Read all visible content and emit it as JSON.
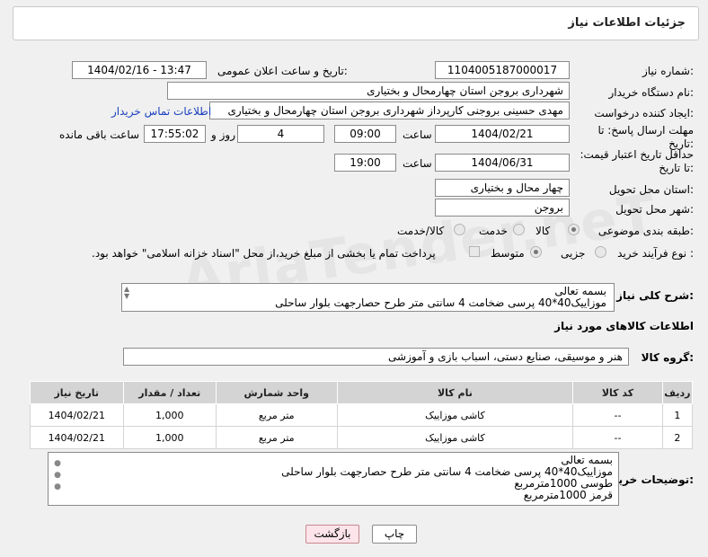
{
  "header": {
    "title": "جزئیات اطلاعات نیاز"
  },
  "watermark": "AriaTender.neT",
  "fields": {
    "need_number_label": "شماره نیاز:",
    "need_number": "1104005187000017",
    "announce_label": "تاریخ و ساعت اعلان عمومی:",
    "announce_value": "1404/02/16 - 13:47",
    "buyer_label": "نام دستگاه خریدار:",
    "buyer_value": "شهرداری بروجن استان چهارمحال و بختیاری",
    "creator_label": "ایجاد کننده درخواست:",
    "creator_value": "مهدی حسینی بروجنی کارپرداز شهرداری بروجن استان چهارمحال و بختیاری",
    "contact_link": "اطلاعات تماس خریدار",
    "deadline_label": "مهلت ارسال پاسخ: تا تاریخ:",
    "deadline_date": "1404/02/21",
    "time_label": "ساعت",
    "deadline_time": "09:00",
    "days_value": "4",
    "days_label": "روز و",
    "remaining_time": "17:55:02",
    "remaining_label": "ساعت باقی مانده",
    "validity_label": "حداقل تاریخ اعتبار قیمت: تا تاریخ:",
    "validity_date": "1404/06/31",
    "validity_time_label": "ساعت",
    "validity_time": "19:00",
    "province_label": "استان محل تحویل:",
    "province_value": "چهار محال و بختیاری",
    "city_label": "شهر محل تحویل:",
    "city_value": "بروجن",
    "category_label": "طبقه بندی موضوعی:",
    "category_options": [
      "کالا",
      "خدمت",
      "کالا/خدمت"
    ],
    "category_selected": "کالا",
    "process_label": "نوع فرآیند خرید :",
    "process_options": [
      "جزیی",
      "متوسط"
    ],
    "process_selected": "متوسط",
    "payment_note": "پرداخت تمام یا بخشی از مبلغ خرید،از محل \"اسناد خزانه اسلامی\" خواهد بود."
  },
  "description": {
    "label": "شرح کلی نیاز:",
    "lines": [
      "بسمه تعالی",
      "موزاییک40*40 پرسی ضخامت 4 سانتی متر طرح حصارجهت بلوار ساحلی"
    ]
  },
  "goods_info_title": "اطلاعات کالاهای مورد نیاز",
  "goods_group": {
    "label": "گروه کالا:",
    "value": "هنر و موسیقی، صنایع دستی، اسباب بازی و آموزشی"
  },
  "table": {
    "headers": [
      "ردیف",
      "کد کالا",
      "نام کالا",
      "واحد شمارش",
      "تعداد / مقدار",
      "تاریخ نیاز"
    ],
    "rows": [
      [
        "1",
        "--",
        "کاشی موزاییک",
        "متر مربع",
        "1,000",
        "1404/02/21"
      ],
      [
        "2",
        "--",
        "کاشی موزاییک",
        "متر مربع",
        "1,000",
        "1404/02/21"
      ]
    ]
  },
  "buyer_notes": {
    "label": "توضیحات خریدار:",
    "lines": [
      "بسمه تعالی",
      "موزاییک40*40 پرسی ضخامت 4 سانتی متر طرح حصارجهت بلوار ساحلی",
      "طوسی 1000مترمربع",
      "قرمز 1000مترمربع"
    ]
  },
  "buttons": {
    "print": "چاپ",
    "back": "بازگشت"
  }
}
